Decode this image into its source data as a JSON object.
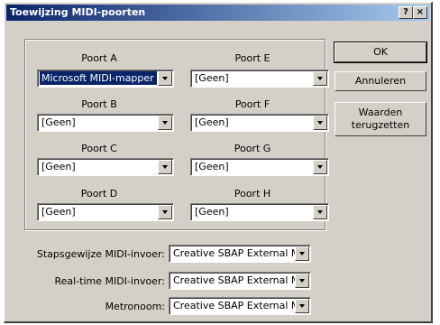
{
  "window": {
    "title": "Toewijzing MIDI-poorten",
    "help_label": "?",
    "close_label": "×"
  },
  "ports": [
    {
      "label": "Poort A",
      "value": "Microsoft MIDI-mapper"
    },
    {
      "label": "Poort B",
      "value": "[Geen]"
    },
    {
      "label": "Poort C",
      "value": "[Geen]"
    },
    {
      "label": "Poort D",
      "value": "[Geen]"
    },
    {
      "label": "Poort E",
      "value": "[Geen]"
    },
    {
      "label": "Poort F",
      "value": "[Geen]"
    },
    {
      "label": "Poort G",
      "value": "[Geen]"
    },
    {
      "label": "Poort H",
      "value": "[Geen]"
    }
  ],
  "inputs": [
    {
      "label": "Stapsgewijze MIDI-invoer:",
      "value": "Creative SBAP External MID"
    },
    {
      "label": "Real-time MIDI-invoer:",
      "value": "Creative SBAP External MID"
    },
    {
      "label": "Metronoom:",
      "value": "Creative SBAP External MID"
    }
  ],
  "buttons": {
    "ok": "OK",
    "cancel": "Annuleren",
    "reset_line1": "Waarden",
    "reset_line2": "terugzetten"
  },
  "colors": {
    "titlebar_start": "#0a246a",
    "titlebar_end": "#a6caf0",
    "face": "#d4d0c8",
    "selection": "#0a246a"
  }
}
